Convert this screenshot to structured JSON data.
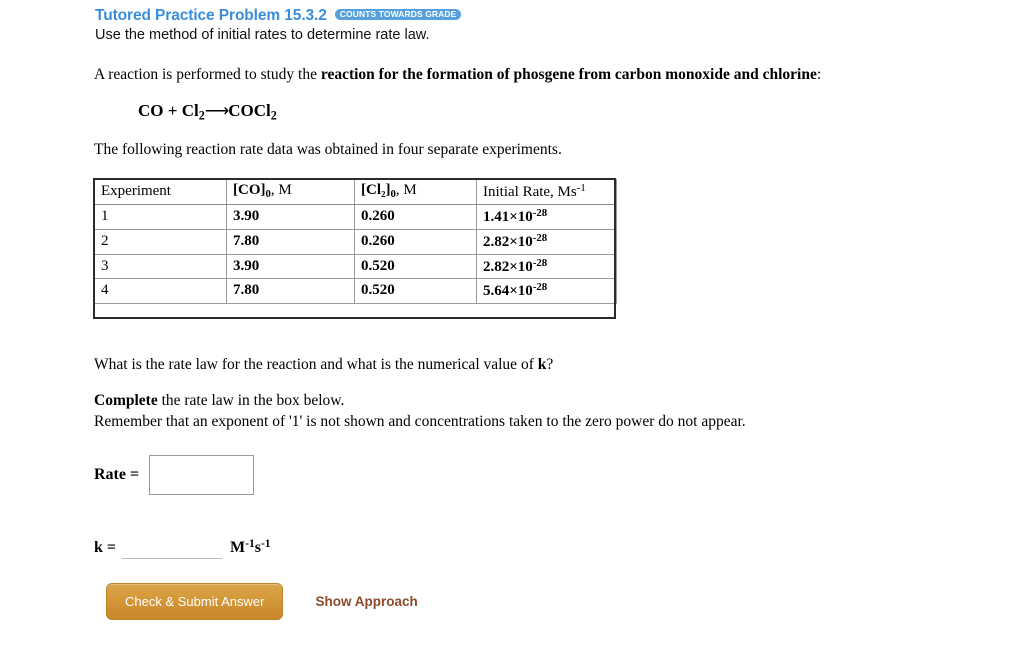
{
  "header": {
    "problem_title": "Tutored Practice Problem 15.3.2",
    "grade_badge": "COUNTS TOWARDS GRADE",
    "subtitle": "Use the method of initial rates to determine rate law.",
    "title_color": "#3a8ddb",
    "badge_color": "#57a0de"
  },
  "intro": {
    "lead_text": "A reaction is performed to study the ",
    "bold_text": "reaction for the formation of phosgene from carbon monoxide and chlorine",
    "trailing_text": ":"
  },
  "equation": {
    "reactant_1": "CO",
    "plus": " + ",
    "reactant_2": "Cl",
    "reactant_2_sub": "2",
    "arrow": "⟶",
    "product": "COCl",
    "product_sub": "2"
  },
  "following_text": "The following reaction rate data was obtained in four separate experiments.",
  "table": {
    "headers": [
      {
        "prefix": "Experiment",
        "bold": "",
        "sub": "",
        "rest": "",
        "sup": ""
      },
      {
        "prefix": "[",
        "bold": "CO",
        "sub": "0",
        "rest": ", M",
        "sup": ""
      },
      {
        "prefix": "[",
        "bold": "Cl₂",
        "sub": "0",
        "rest": ", M",
        "sup": ""
      },
      {
        "prefix": "Initial Rate, Ms",
        "bold": "",
        "sub": "",
        "rest": "",
        "sup": "-1"
      }
    ],
    "header_labels": [
      "Experiment",
      "[CO]0, M",
      "[Cl2]0, M",
      "Initial Rate, Ms-1"
    ],
    "rows": [
      {
        "experiment": "1",
        "co": "3.90",
        "cl2": "0.260",
        "rate_mantissa": "1.41×10",
        "rate_exponent": "-28"
      },
      {
        "experiment": "2",
        "co": "7.80",
        "cl2": "0.260",
        "rate_mantissa": "2.82×10",
        "rate_exponent": "-28"
      },
      {
        "experiment": "3",
        "co": "3.90",
        "cl2": "0.520",
        "rate_mantissa": "2.82×10",
        "rate_exponent": "-28"
      },
      {
        "experiment": "4",
        "co": "7.80",
        "cl2": "0.520",
        "rate_mantissa": "5.64×10",
        "rate_exponent": "-28"
      }
    ]
  },
  "question": {
    "text_before_k": "What is the rate law for the reaction and what is the numerical value of ",
    "k_symbol": "k",
    "text_after_k": "?"
  },
  "instructions": {
    "complete_bold": "Complete",
    "complete_rest": " the rate law in the box below.",
    "remember": "Remember that an exponent of '1' is not shown and concentrations taken to the zero power do not appear."
  },
  "answer": {
    "rate_label": "Rate =",
    "rate_value": "",
    "rate_placeholder": "",
    "k_label": "k =",
    "k_value": "",
    "k_placeholder": "",
    "k_units_base_1": "M",
    "k_units_sup_1": "-1",
    "k_units_base_2": "s",
    "k_units_sup_2": "-1"
  },
  "actions": {
    "submit_label": "Check & Submit Answer",
    "approach_label": "Show Approach",
    "submit_color": "#d39838",
    "approach_color": "#8a4a2b"
  }
}
